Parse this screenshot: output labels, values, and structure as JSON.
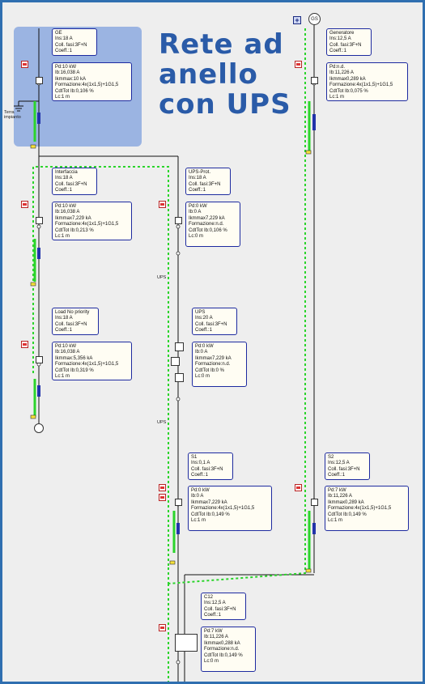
{
  "heading": {
    "line1": "Rete ad",
    "line2": "anello",
    "line3": "con UPS"
  },
  "labels": {
    "earth": "Terra impianto",
    "ups_a": "UPS",
    "ups_b": "UPS",
    "generator": "GS",
    "add": "+"
  },
  "nodes": {
    "ge": {
      "title": "GE",
      "lines": [
        "Ins:18 A",
        "Coll. fasi:3F+N",
        "Coeff.:1"
      ],
      "data": [
        "Pd:10 kW",
        "Ib:16,038 A",
        "Ikmmax:10 kA",
        "Formazione:4x(1x1,5)+1G1,5",
        "CdtTot Ib:0,106 %",
        "Lc:1 m"
      ]
    },
    "generatore": {
      "title": "Generatore",
      "lines": [
        "Ins:12,5 A",
        "Coll. fasi:3F+N",
        "Coeff.:1"
      ],
      "data": [
        "Pd:n.d.",
        "Ib:11,226 A",
        "Ikmmax0,289 kA",
        "Formazione:4x(1x1,5)+1G1,5",
        "CdtTot Ib:0,075 %",
        "Lc:1 m"
      ]
    },
    "interfaccia": {
      "title": "Interfaccia",
      "lines": [
        "Ins:18 A",
        "Coll. fasi:3F+N",
        "Coeff.:1"
      ],
      "data": [
        "Pd:10 kW",
        "Ib:16,038 A",
        "Ikmmax7,229 kA",
        "Formazione:4x(1x1,5)+1G1,5",
        "CdtTot Ib:0,213 %",
        "Lc:1 m"
      ]
    },
    "ups_prot": {
      "title": "UPS-Prot.",
      "lines": [
        "Ins:18 A",
        "Coll. fasi:3F+N",
        "Coeff.:1"
      ],
      "data": [
        "Pd:0 kW",
        "Ib:0 A",
        "Ikmmax7,229 kA",
        "Formazione:n.d.",
        "CdtTot Ib:0,106 %",
        "Lc:0 m"
      ]
    },
    "load": {
      "title": "Load No priority",
      "lines": [
        "Ins:18 A",
        "Coll. fasi:3F+N",
        "Coeff.:1"
      ],
      "data": [
        "Pd:10 kW",
        "Ib:16,038 A",
        "Ikmmax:5,356 kA",
        "Formazione:4x(1x1,5)+1G1,5",
        "CdtTot Ib:0,319 %",
        "Lc:1 m"
      ]
    },
    "ups": {
      "title": "UPS",
      "lines": [
        "Ins:20 A",
        "Coll. fasi:3F+N",
        "Coeff.:1"
      ],
      "data": [
        "Pd:0 kW",
        "Ib:0 A",
        "Ikmmax7,229 kA",
        "Formazione:n.d.",
        "CdtTot Ib:0 %",
        "Lc:0 m"
      ]
    },
    "s1": {
      "title": "S1",
      "lines": [
        "Ins:0,1 A",
        "Coll. fasi:3F+N",
        "Coeff.:1"
      ],
      "data": [
        "Pd:0 kW",
        "Ib:0 A",
        "Ikmmax7,229 kA",
        "Formazione:4x(1x1,5)+1G1,5",
        "CdtTot Ib:0,149 %",
        "Lc:1 m"
      ]
    },
    "s2": {
      "title": "S2",
      "lines": [
        "Ins:12,5 A",
        "Coll. fasi:3F+N",
        "Coeff.:1"
      ],
      "data": [
        "Pd:7 kW",
        "Ib:11,226 A",
        "Ikmmax0,289 kA",
        "Formazione:4x(1x1,5)+1G1,5",
        "CdtTot Ib:0,149 %",
        "Lc:1 m"
      ]
    },
    "c12": {
      "title": "C12",
      "lines": [
        "Ins:12,5 A",
        "Coll. fasi:3F+N",
        "Coeff.:1"
      ],
      "data": [
        "Pd:7 kW",
        "Ib:11,226 A",
        "Ikmmax0,288 kA",
        "Formazione:n.d.",
        "CdtTot Ib:0,149 %",
        "Lc:0 m"
      ]
    }
  },
  "colors": {
    "background": "#eeeeee",
    "heading": "#2a5ba8",
    "ge_area": "#9bb4e2",
    "box_border": "#1d2aa0",
    "cable": "#2bd42b",
    "ring": "#2bd42b"
  }
}
